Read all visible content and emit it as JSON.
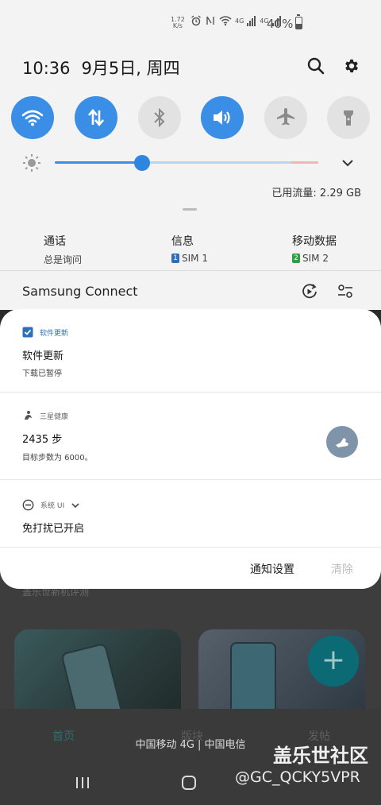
{
  "status_bar": {
    "net_speed_value": "1.72",
    "net_speed_unit": "K/s",
    "network_labels": [
      "4G",
      "4G"
    ],
    "battery_percent": "40%",
    "battery_level": 0.4
  },
  "header": {
    "time": "10:36",
    "date": "9月5日, 周四"
  },
  "quick_toggles": [
    {
      "name": "wifi",
      "on": true
    },
    {
      "name": "mobile-data",
      "on": true
    },
    {
      "name": "bluetooth",
      "on": false
    },
    {
      "name": "sound",
      "on": true
    },
    {
      "name": "airplane",
      "on": false
    },
    {
      "name": "flashlight",
      "on": false
    }
  ],
  "brightness": {
    "level": 0.33
  },
  "data_usage": "已用流量: 2.29 GB",
  "sim_settings": {
    "call": {
      "title": "通话",
      "value": "总是询问"
    },
    "message": {
      "title": "信息",
      "badge": "1",
      "value": "SIM 1"
    },
    "mobile_data": {
      "title": "移动数据",
      "badge": "2",
      "value": "SIM 2"
    }
  },
  "samsung_connect": {
    "title": "Samsung Connect"
  },
  "notifications": [
    {
      "app": "软件更新",
      "title": "软件更新",
      "body": "下载已暂停"
    },
    {
      "app": "三星健康",
      "title": "2435 步",
      "body": "目标步数为 6000。"
    },
    {
      "app": "系统 UI",
      "title": "免打扰已开启",
      "body": ""
    }
  ],
  "footer": {
    "settings": "通知设置",
    "clear": "清除"
  },
  "background_app": {
    "title": "盖乐世新机评测",
    "tabs": [
      "首页",
      "版块",
      "发帖"
    ]
  },
  "carrier": "中国移动 4G | 中国电信",
  "watermark": {
    "title": "盖乐世社区",
    "handle": "@GC_QCKY5VPR"
  },
  "colors": {
    "accent": "#3a8ee6",
    "toggle_off": "#e2e2e2",
    "panel": "#ffffff",
    "shade": "#f3f3f3",
    "sim1": "#2f6fb8",
    "sim2": "#2ea043"
  }
}
